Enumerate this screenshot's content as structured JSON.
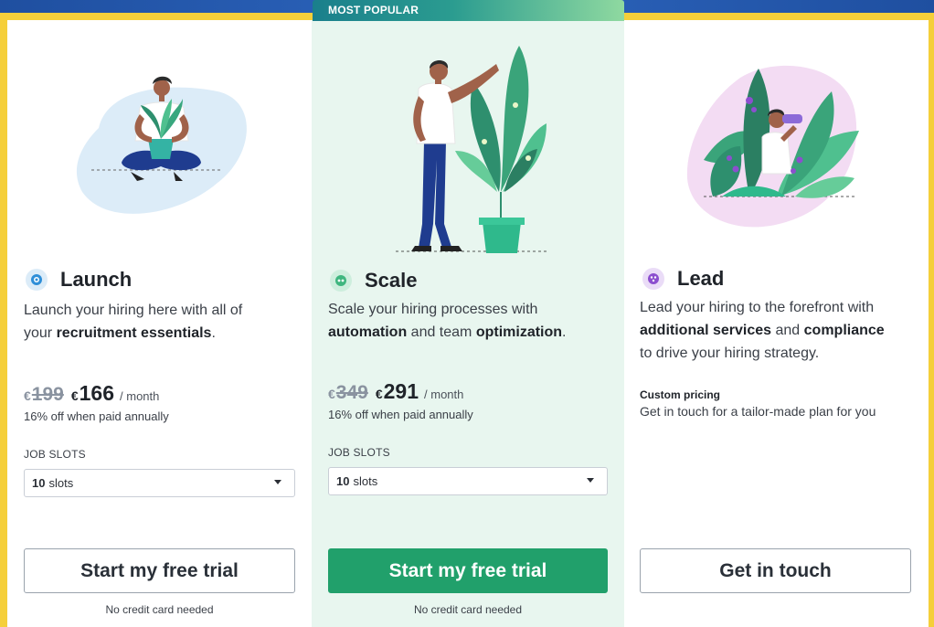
{
  "ribbon": {
    "label": "MOST POPULAR"
  },
  "plans": [
    {
      "name": "Launch",
      "desc_1": "Launch your hiring here with all of",
      "desc_2a": "your ",
      "desc_2b": "recruitment essentials",
      "desc_2c": ".",
      "currency": "€",
      "old_price": "199",
      "new_price": "166",
      "per": "/ month",
      "discount": "16% off when paid annually",
      "slots_label": "JOB SLOTS",
      "slots_value": "10",
      "slots_unit": "slots",
      "cta": "Start my free trial",
      "note": "No credit card needed",
      "icon": "target-icon",
      "icon_color": "#2f8fd8"
    },
    {
      "name": "Scale",
      "desc_1": "Scale your hiring processes with",
      "desc_2a": "automation",
      "desc_2b": " and team ",
      "desc_2c": "optimization",
      "desc_2d": ".",
      "currency": "€",
      "old_price": "349",
      "new_price": "291",
      "per": "/ month",
      "discount": "16% off when paid annually",
      "slots_label": "JOB SLOTS",
      "slots_value": "10",
      "slots_unit": "slots",
      "cta": "Start my free trial",
      "note": "No credit card needed",
      "icon": "dots-icon",
      "icon_color": "#3fb67f"
    },
    {
      "name": "Lead",
      "desc_1": "Lead your hiring to the forefront with",
      "desc_2a": "additional services",
      "desc_2b": " and ",
      "desc_2c": "compliance",
      "desc_3": "to drive your hiring strategy.",
      "custom_title": "Custom pricing",
      "custom_sub": "Get in touch for a tailor-made plan for you",
      "cta": "Get in touch",
      "icon": "grid-dots-icon",
      "icon_color": "#8c4fcf"
    }
  ],
  "colors": {
    "accent_green": "#21a06b",
    "frame_yellow": "#f5cf3a",
    "top_blue": "#2a61b8",
    "mid_bg": "#e8f6ef"
  }
}
